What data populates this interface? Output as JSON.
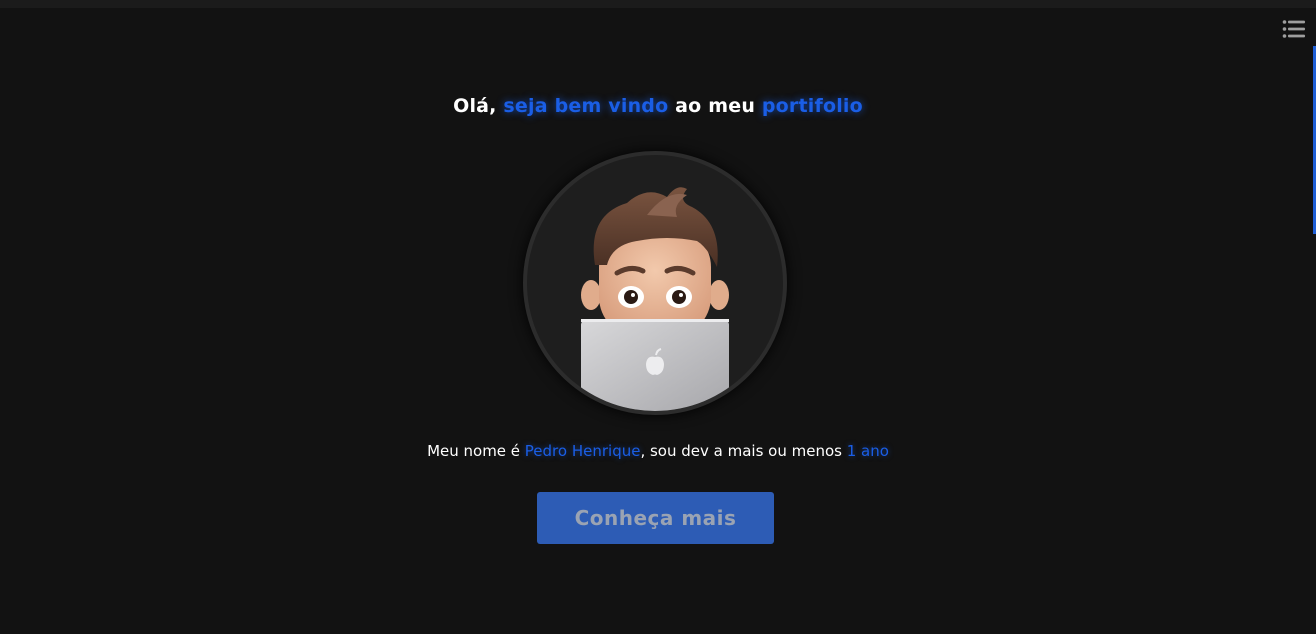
{
  "hero": {
    "greeting_lead": "Olá, ",
    "greeting_accent_1": "seja bem vindo",
    "greeting_middle": " ao meu ",
    "greeting_accent_2": "portifolio"
  },
  "intro": {
    "prefix": "Meu nome é ",
    "name": "Pedro Henrique",
    "middle": ", sou dev a mais ou menos ",
    "duration": "1 ano"
  },
  "cta": {
    "label": "Conheça mais"
  },
  "icons": {
    "menu": "list-menu-icon",
    "avatar": "memoji-with-laptop-avatar"
  },
  "colors": {
    "background": "#121212",
    "accent": "#1a5ee6",
    "button": "#2d5cb5",
    "button_text": "#9aa3b3"
  }
}
